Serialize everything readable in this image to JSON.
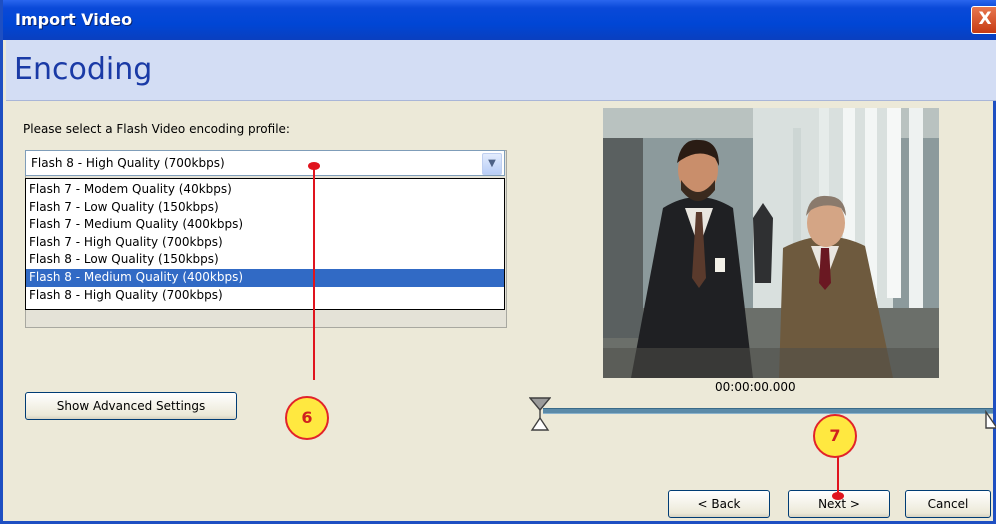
{
  "window": {
    "title": "Import Video",
    "close_label": "X"
  },
  "header": {
    "heading": "Encoding"
  },
  "profile": {
    "prompt": "Please select a Flash Video encoding profile:",
    "selected": "Flash 8 - High Quality (700kbps)",
    "options": [
      "Flash 7 - Modem Quality (40kbps)",
      "Flash 7 - Low Quality (150kbps)",
      "Flash 7 - Medium Quality (400kbps)",
      "Flash 7 - High Quality (700kbps)",
      "Flash 8 - Low Quality (150kbps)",
      "Flash 8 - Medium Quality (400kbps)",
      "Flash 8 - High Quality (700kbps)"
    ],
    "highlighted_option": "Flash 8 - Medium Quality (400kbps)"
  },
  "buttons": {
    "advanced": "Show Advanced Settings",
    "back": "< Back",
    "next": "Next >",
    "cancel": "Cancel"
  },
  "preview": {
    "timecode": "00:00:00.000"
  },
  "callouts": {
    "first": "6",
    "second": "7"
  },
  "colors": {
    "titlebar": "#0046d5",
    "header_band": "#d3ddf4",
    "selection": "#316ac5",
    "callout_fill": "#ffe840",
    "callout_border": "#e2232a"
  }
}
